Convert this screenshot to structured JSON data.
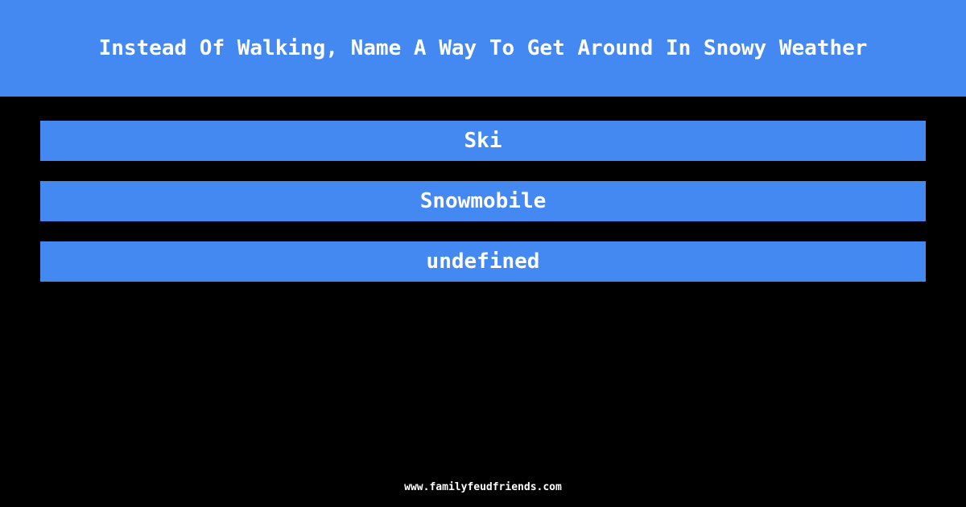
{
  "question": "Instead Of Walking, Name A Way To Get Around In Snowy Weather",
  "answers": [
    {
      "label": "Ski"
    },
    {
      "label": "Snowmobile"
    },
    {
      "label": "undefined"
    }
  ],
  "footer": "www.familyfeudfriends.com",
  "colors": {
    "accent": "#4488f2",
    "background": "#000000",
    "text": "#ffffff"
  }
}
